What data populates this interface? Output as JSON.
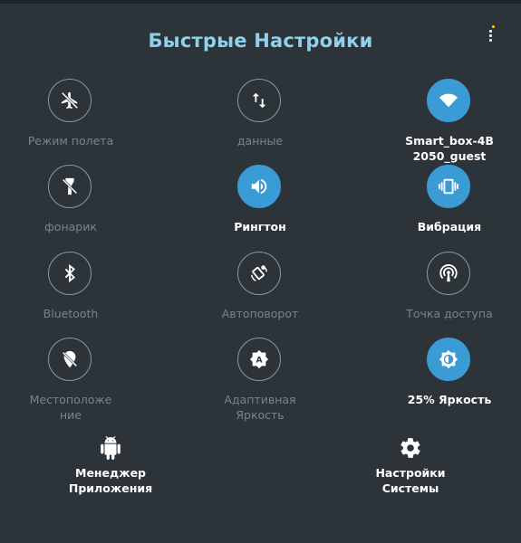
{
  "header": {
    "title": "Быстрые Настройки"
  },
  "tiles": [
    {
      "label1": "Режим полета",
      "label2": "",
      "active": false,
      "icon": "airplane-icon"
    },
    {
      "label1": "данные",
      "label2": "",
      "active": false,
      "icon": "data-arrows-icon"
    },
    {
      "label1": "Smart_box-4B",
      "label2": "2050_guest",
      "active": true,
      "icon": "wifi-icon"
    },
    {
      "label1": "фонарик",
      "label2": "",
      "active": false,
      "icon": "flashlight-icon"
    },
    {
      "label1": "Рингтон",
      "label2": "",
      "active": true,
      "icon": "speaker-icon"
    },
    {
      "label1": "Вибрация",
      "label2": "",
      "active": true,
      "icon": "vibration-icon"
    },
    {
      "label1": "Bluetooth",
      "label2": "",
      "active": false,
      "icon": "bluetooth-icon"
    },
    {
      "label1": "Автоповорот",
      "label2": "",
      "active": false,
      "icon": "auto-rotate-icon"
    },
    {
      "label1": "Точка доступа",
      "label2": "",
      "active": false,
      "icon": "hotspot-icon"
    },
    {
      "label1": "Местоположе",
      "label2": "ние",
      "active": false,
      "icon": "location-off-icon"
    },
    {
      "label1": "Адаптивная",
      "label2": "Яркость",
      "active": false,
      "icon": "adaptive-brightness-icon"
    },
    {
      "label1": "25% Яркость",
      "label2": "",
      "active": true,
      "icon": "brightness-icon"
    }
  ],
  "bottom": {
    "app_manager": {
      "line1": "Менеджер",
      "line2": "Приложения",
      "icon": "android-icon"
    },
    "system_settings": {
      "line1": "Настройки",
      "line2": "Системы",
      "icon": "gear-icon"
    }
  },
  "colors": {
    "background": "#2c3439",
    "accent": "#3b9bd4",
    "title": "#8fd0ea",
    "inactive_label": "#7a8488"
  }
}
